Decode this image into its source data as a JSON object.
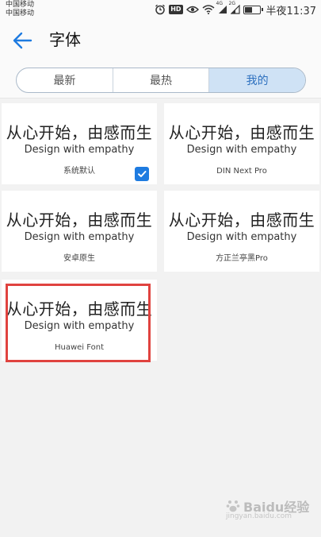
{
  "status_bar": {
    "carrier_1": "中国移动",
    "carrier_2": "中国移动",
    "hd_badge": "HD",
    "network_4g": "4G",
    "network_2g": "2G",
    "battery_level": 0.55,
    "time": "半夜11:37"
  },
  "header": {
    "back_icon": "arrow-left-icon",
    "title": "字体"
  },
  "tabs": [
    {
      "label": "最新",
      "active": false
    },
    {
      "label": "最热",
      "active": false
    },
    {
      "label": "我的",
      "active": true
    }
  ],
  "fonts": [
    {
      "preview_zh": "从心开始，由感而生",
      "preview_en": "Design with empathy",
      "name": "系统默认",
      "selected": true
    },
    {
      "preview_zh": "从心开始，由感而生",
      "preview_en": "Design with empathy",
      "name": "DIN Next Pro",
      "selected": false
    },
    {
      "preview_zh": "从心开始，由感而生",
      "preview_en": "Design with empathy",
      "name": "安卓原生",
      "selected": false
    },
    {
      "preview_zh": "从心开始，由感而生",
      "preview_en": "Design with empathy",
      "name": "方正兰亭黑Pro",
      "selected": false
    },
    {
      "preview_zh": "从心开始，由感而生",
      "preview_en": "Design with empathy",
      "name": "Huawei Font",
      "selected": false
    }
  ],
  "colors": {
    "accent": "#1e7be0",
    "tab_active_bg": "#cfe2f5",
    "tab_active_text": "#2b6fbe",
    "highlight": "#e0433f"
  },
  "watermark": {
    "text": "Baidu经验",
    "url": "jingyan.baidu.com"
  }
}
